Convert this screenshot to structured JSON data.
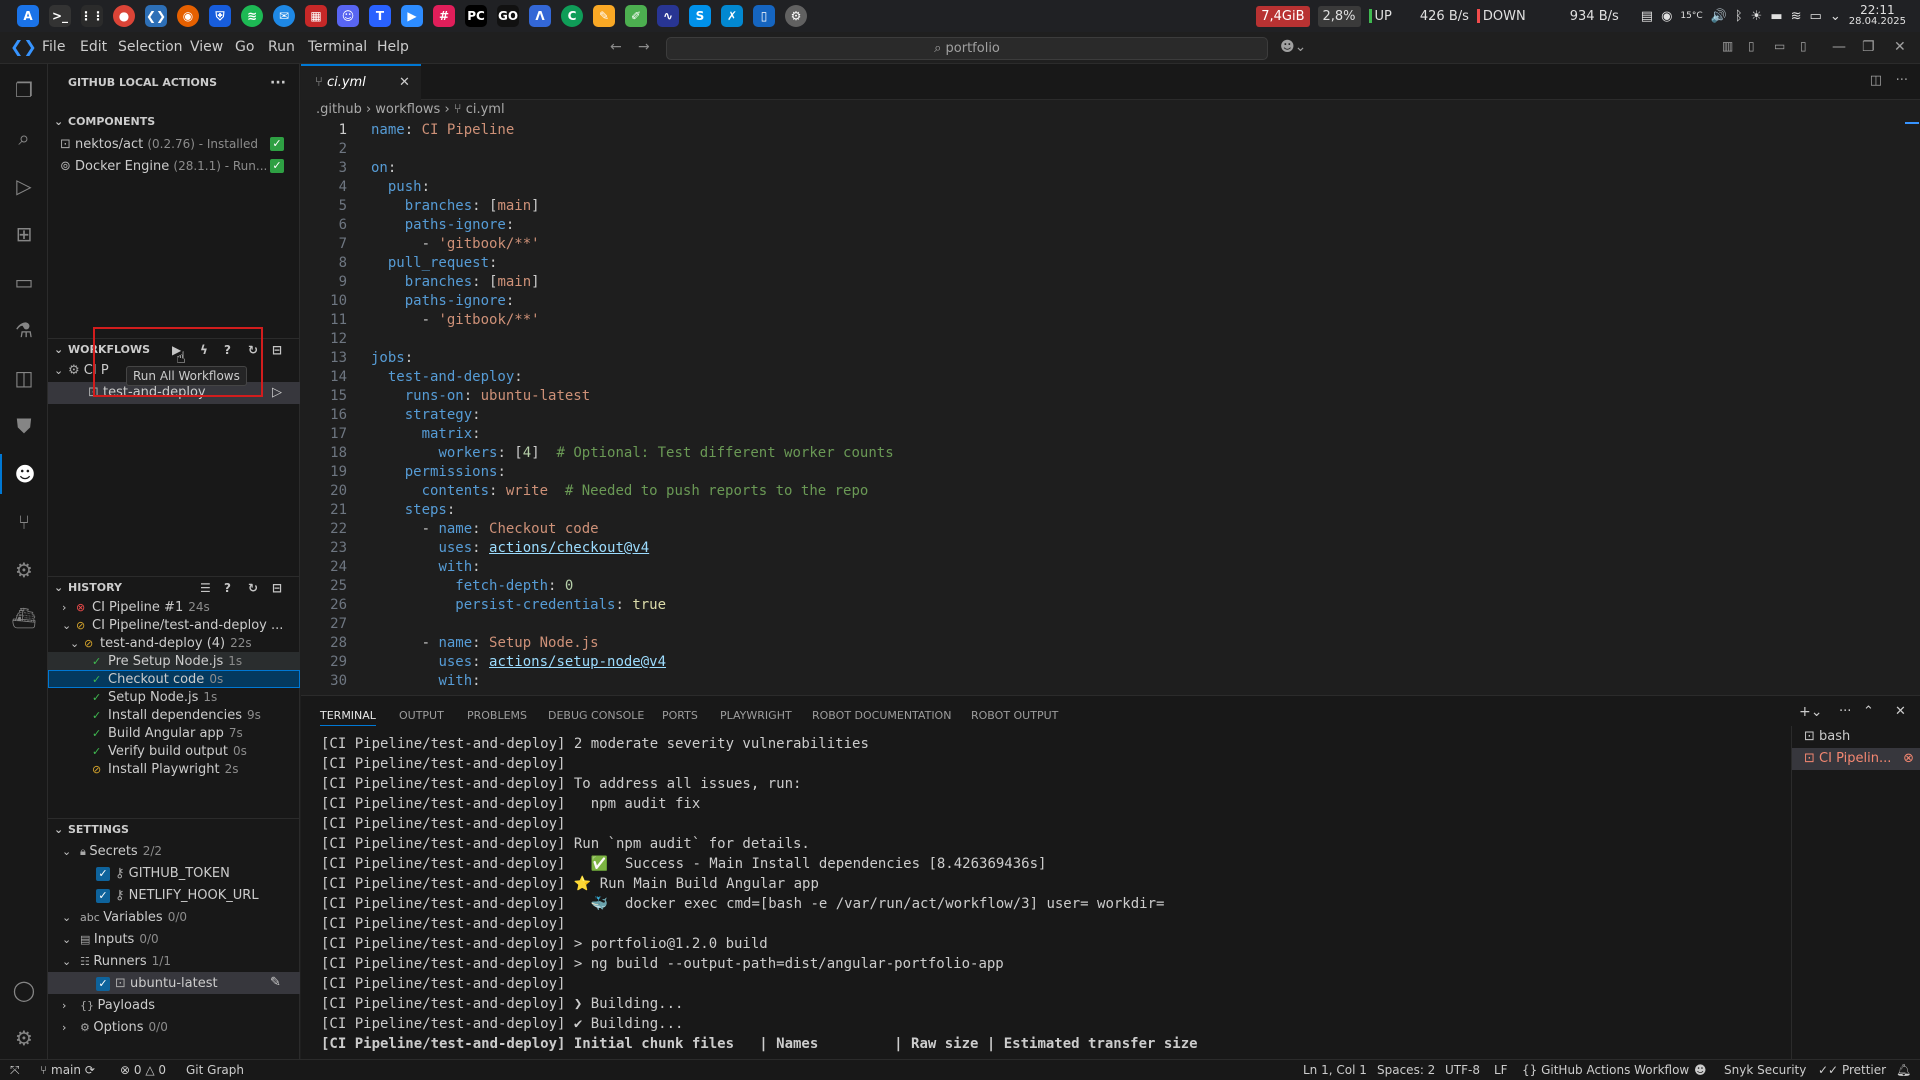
{
  "taskbar": {
    "ram": "7,4GiB",
    "cpu": "2,8%",
    "up_label": "UP",
    "up_speed": "426 B/s",
    "down_label": "DOWN",
    "down_speed": "934 B/s",
    "temp": "15°C",
    "time": "22:11",
    "date": "28.04.2025"
  },
  "menu": [
    "File",
    "Edit",
    "Selection",
    "View",
    "Go",
    "Run",
    "Terminal",
    "Help"
  ],
  "command_center": "portfolio",
  "sidebar": {
    "title": "GITHUB LOCAL ACTIONS",
    "components_header": "COMPONENTS",
    "components": [
      {
        "name": "nektos/act",
        "detail": "(0.2.76) - Installed"
      },
      {
        "name": "Docker Engine",
        "detail": "(28.1.1) - Run..."
      }
    ],
    "workflows_header": "WORKFLOWS",
    "workflow_name": "CI P",
    "workflow_job": "test-and-deploy",
    "tooltip": "Run All Workflows",
    "history_header": "HISTORY",
    "history": [
      {
        "label": "CI Pipeline #1",
        "time": "24s",
        "status": "error",
        "indent": 1,
        "chev": "›"
      },
      {
        "label": "CI Pipeline/test-and-deploy ...",
        "time": "",
        "status": "warn",
        "indent": 1,
        "chev": "⌄"
      },
      {
        "label": "test-and-deploy (4)",
        "time": "22s",
        "status": "warn",
        "indent": 2,
        "chev": "⌄"
      },
      {
        "label": "Pre Setup Node.js",
        "time": "1s",
        "status": "ok",
        "indent": 3,
        "chev": ""
      },
      {
        "label": "Checkout code",
        "time": "0s",
        "status": "ok",
        "indent": 3,
        "chev": ""
      },
      {
        "label": "Setup Node.js",
        "time": "1s",
        "status": "ok",
        "indent": 3,
        "chev": ""
      },
      {
        "label": "Install dependencies",
        "time": "9s",
        "status": "ok",
        "indent": 3,
        "chev": ""
      },
      {
        "label": "Build Angular app",
        "time": "7s",
        "status": "ok",
        "indent": 3,
        "chev": ""
      },
      {
        "label": "Verify build output",
        "time": "0s",
        "status": "ok",
        "indent": 3,
        "chev": ""
      },
      {
        "label": "Install Playwright",
        "time": "2s",
        "status": "warn",
        "indent": 3,
        "chev": ""
      }
    ],
    "settings_header": "SETTINGS",
    "settings": [
      {
        "label": "Secrets",
        "count": "2/2",
        "indent": 1,
        "chev": "⌄",
        "check": false
      },
      {
        "label": "GITHUB_TOKEN",
        "count": "",
        "indent": 2,
        "chev": "",
        "check": true
      },
      {
        "label": "NETLIFY_HOOK_URL",
        "count": "",
        "indent": 2,
        "chev": "",
        "check": true
      },
      {
        "label": "Variables",
        "count": "0/0",
        "indent": 1,
        "chev": "⌄",
        "check": false
      },
      {
        "label": "Inputs",
        "count": "0/0",
        "indent": 1,
        "chev": "⌄",
        "check": false
      },
      {
        "label": "Runners",
        "count": "1/1",
        "indent": 1,
        "chev": "⌄",
        "check": false
      },
      {
        "label": "ubuntu-latest",
        "count": "",
        "indent": 2,
        "chev": "",
        "check": true
      },
      {
        "label": "Payloads",
        "count": "",
        "indent": 1,
        "chev": "›",
        "check": false
      },
      {
        "label": "Options",
        "count": "0/0",
        "indent": 1,
        "chev": "›",
        "check": false
      }
    ]
  },
  "editor": {
    "tab": "ci.yml",
    "breadcrumb": [
      ".github",
      "workflows",
      "ci.yml"
    ],
    "lines": [
      [
        [
          "k",
          "name"
        ],
        [
          "p",
          ": "
        ],
        [
          "s",
          "CI Pipeline"
        ]
      ],
      [],
      [
        [
          "k",
          "on"
        ],
        [
          "p",
          ":"
        ]
      ],
      [
        [
          "p",
          "  "
        ],
        [
          "k",
          "push"
        ],
        [
          "p",
          ":"
        ]
      ],
      [
        [
          "p",
          "    "
        ],
        [
          "k",
          "branches"
        ],
        [
          "p",
          ": ["
        ],
        [
          "s",
          "main"
        ],
        [
          "p",
          "]"
        ]
      ],
      [
        [
          "p",
          "    "
        ],
        [
          "k",
          "paths-ignore"
        ],
        [
          "p",
          ":"
        ]
      ],
      [
        [
          "p",
          "      - "
        ],
        [
          "s",
          "'gitbook/**'"
        ]
      ],
      [
        [
          "p",
          "  "
        ],
        [
          "k",
          "pull_request"
        ],
        [
          "p",
          ":"
        ]
      ],
      [
        [
          "p",
          "    "
        ],
        [
          "k",
          "branches"
        ],
        [
          "p",
          ": ["
        ],
        [
          "s",
          "main"
        ],
        [
          "p",
          "]"
        ]
      ],
      [
        [
          "p",
          "    "
        ],
        [
          "k",
          "paths-ignore"
        ],
        [
          "p",
          ":"
        ]
      ],
      [
        [
          "p",
          "      - "
        ],
        [
          "s",
          "'gitbook/**'"
        ]
      ],
      [],
      [
        [
          "k",
          "jobs"
        ],
        [
          "p",
          ":"
        ]
      ],
      [
        [
          "p",
          "  "
        ],
        [
          "k",
          "test-and-deploy"
        ],
        [
          "p",
          ":"
        ]
      ],
      [
        [
          "p",
          "    "
        ],
        [
          "k",
          "runs-on"
        ],
        [
          "p",
          ": "
        ],
        [
          "s",
          "ubuntu-latest"
        ]
      ],
      [
        [
          "p",
          "    "
        ],
        [
          "k",
          "strategy"
        ],
        [
          "p",
          ":"
        ]
      ],
      [
        [
          "p",
          "      "
        ],
        [
          "k",
          "matrix"
        ],
        [
          "p",
          ":"
        ]
      ],
      [
        [
          "p",
          "        "
        ],
        [
          "k",
          "workers"
        ],
        [
          "p",
          ": ["
        ],
        [
          "n",
          "4"
        ],
        [
          "p",
          "]  "
        ],
        [
          "c",
          "# Optional: Test different worker counts"
        ]
      ],
      [
        [
          "p",
          "    "
        ],
        [
          "k",
          "permissions"
        ],
        [
          "p",
          ":"
        ]
      ],
      [
        [
          "p",
          "      "
        ],
        [
          "k",
          "contents"
        ],
        [
          "p",
          ": "
        ],
        [
          "s",
          "write"
        ],
        [
          "p",
          "  "
        ],
        [
          "c",
          "# Needed to push reports to the repo"
        ]
      ],
      [
        [
          "p",
          "    "
        ],
        [
          "k",
          "steps"
        ],
        [
          "p",
          ":"
        ]
      ],
      [
        [
          "p",
          "      - "
        ],
        [
          "k",
          "name"
        ],
        [
          "p",
          ": "
        ],
        [
          "s",
          "Checkout code"
        ]
      ],
      [
        [
          "p",
          "        "
        ],
        [
          "k",
          "uses"
        ],
        [
          "p",
          ": "
        ],
        [
          "u",
          "actions/checkout@v4"
        ]
      ],
      [
        [
          "p",
          "        "
        ],
        [
          "k",
          "with"
        ],
        [
          "p",
          ":"
        ]
      ],
      [
        [
          "p",
          "          "
        ],
        [
          "k",
          "fetch-depth"
        ],
        [
          "p",
          ": "
        ],
        [
          "n",
          "0"
        ]
      ],
      [
        [
          "p",
          "          "
        ],
        [
          "k",
          "persist-credentials"
        ],
        [
          "p",
          ": "
        ],
        [
          "b",
          "true"
        ]
      ],
      [],
      [
        [
          "p",
          "      - "
        ],
        [
          "k",
          "name"
        ],
        [
          "p",
          ": "
        ],
        [
          "s",
          "Setup Node.js"
        ]
      ],
      [
        [
          "p",
          "        "
        ],
        [
          "k",
          "uses"
        ],
        [
          "p",
          ": "
        ],
        [
          "u",
          "actions/setup-node@v4"
        ]
      ],
      [
        [
          "p",
          "        "
        ],
        [
          "k",
          "with"
        ],
        [
          "p",
          ":"
        ]
      ]
    ]
  },
  "panel": {
    "tabs": [
      "TERMINAL",
      "OUTPUT",
      "PROBLEMS",
      "DEBUG CONSOLE",
      "PORTS",
      "PLAYWRIGHT",
      "ROBOT DOCUMENTATION",
      "ROBOT OUTPUT"
    ],
    "terminals": [
      "bash",
      "CI Pipelin..."
    ],
    "lines": [
      "[CI Pipeline/test-and-deploy] 2 moderate severity vulnerabilities",
      "[CI Pipeline/test-and-deploy]",
      "[CI Pipeline/test-and-deploy] To address all issues, run:",
      "[CI Pipeline/test-and-deploy]   npm audit fix",
      "[CI Pipeline/test-and-deploy]",
      "[CI Pipeline/test-and-deploy] Run `npm audit` for details.",
      "[CI Pipeline/test-and-deploy]   ✅  Success - Main Install dependencies [8.426369436s]",
      "[CI Pipeline/test-and-deploy] ⭐ Run Main Build Angular app",
      "[CI Pipeline/test-and-deploy]   🐳  docker exec cmd=[bash -e /var/run/act/workflow/3] user= workdir=",
      "[CI Pipeline/test-and-deploy]",
      "[CI Pipeline/test-and-deploy] > portfolio@1.2.0 build",
      "[CI Pipeline/test-and-deploy] > ng build --output-path=dist/angular-portfolio-app",
      "[CI Pipeline/test-and-deploy]",
      "[CI Pipeline/test-and-deploy] ❯ Building...",
      "[CI Pipeline/test-and-deploy] ✔ Building...",
      "[CI Pipeline/test-and-deploy] Initial chunk files   | Names         | Raw size | Estimated transfer size"
    ]
  },
  "status": {
    "branch": "main",
    "errors": "0",
    "warnings": "0",
    "git_graph": "Git Graph",
    "position": "Ln 1, Col 1",
    "spaces": "Spaces: 2",
    "encoding": "UTF-8",
    "eol": "LF",
    "language": "GitHub Actions Workflow",
    "snyk": "Snyk Security",
    "prettier": "Prettier"
  },
  "colors": {
    "accent": "#0078d4",
    "ram_badge": "#b83232",
    "cpu_badge": "#3a3a3a"
  }
}
